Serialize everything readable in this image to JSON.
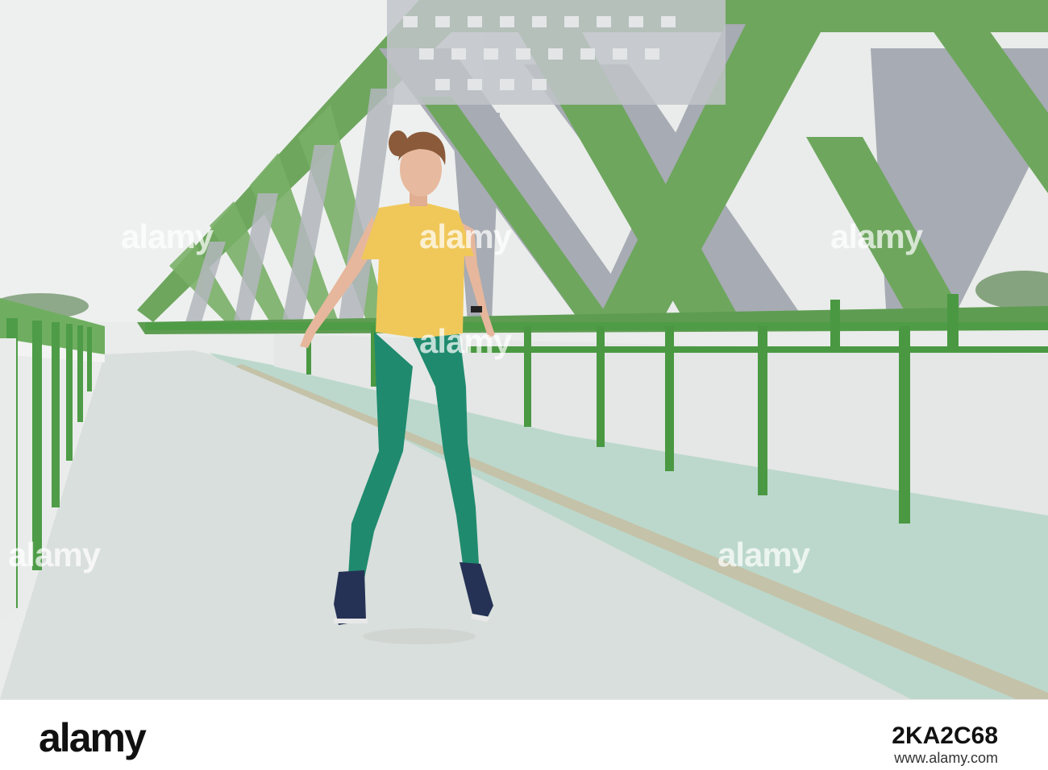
{
  "photo": {
    "watermark": "alamy",
    "colors": {
      "sky": "#e8ecea",
      "bridge_green": "#6ea65e",
      "steel_gray": "#a6aab2",
      "deck": "#d9dfdc",
      "bike_lane": "#b9d6c9",
      "tshirt": "#f0c85a",
      "leggings": "#1f8a6e",
      "shoes": "#253255"
    }
  },
  "footer": {
    "brand": "alamy",
    "image_id": "2KA2C68",
    "url": "www.alamy.com"
  }
}
